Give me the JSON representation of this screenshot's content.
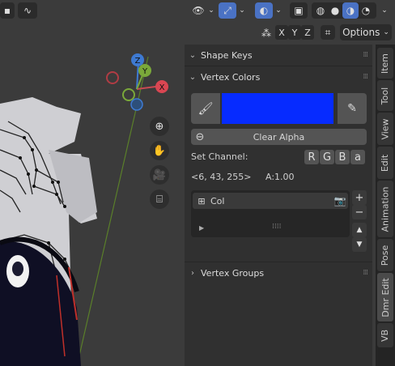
{
  "header": {
    "options_label": "Options",
    "axis_x": "X",
    "axis_y": "Y",
    "axis_z": "Z"
  },
  "gizmo": {
    "x": "X",
    "y": "Y",
    "z": "Z"
  },
  "panel": {
    "shape_keys": "Shape Keys",
    "vertex_colors": "Vertex Colors",
    "clear_alpha": "Clear Alpha",
    "set_channel": "Set Channel:",
    "channels": [
      "R",
      "G",
      "B",
      "a"
    ],
    "color_value": "<6, 43, 255>",
    "alpha_value": "A:1.00",
    "layer_name": "Col",
    "vertex_groups": "Vertex Groups",
    "swatch_color": "#062bff"
  },
  "tabs": [
    "Item",
    "Tool",
    "View",
    "Edit",
    "Animation",
    "Pose",
    "Dmr Edit",
    "VB"
  ]
}
